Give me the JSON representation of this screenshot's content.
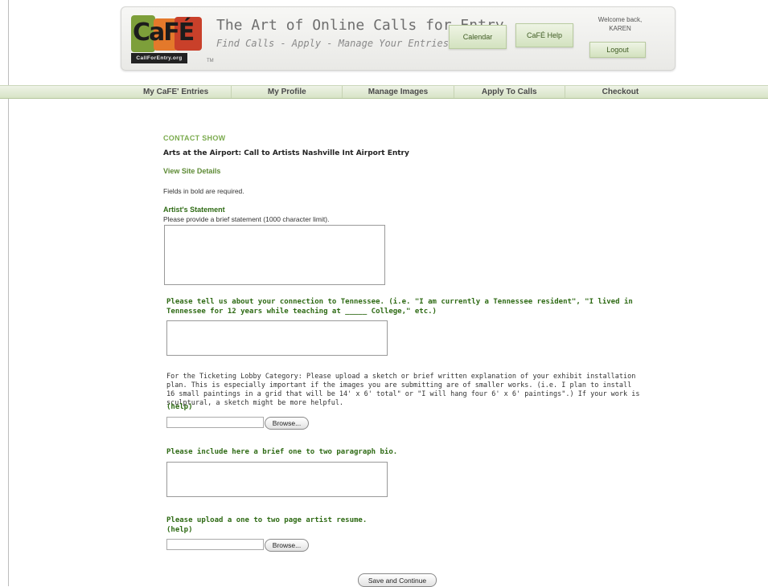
{
  "header": {
    "logo_text": "CaFÉ",
    "logo_sub": "CallForEntry.org",
    "trademark": "TM",
    "tagline_main": "The Art of Online Calls for Entry",
    "tagline_sub": "Find Calls - Apply - Manage Your Entries",
    "calendar_label": "Calendar",
    "help_label": "CaFÉ Help",
    "welcome_line1": "Welcome back,",
    "welcome_name": "KAREN",
    "logout_label": "Logout"
  },
  "nav": {
    "items": [
      "My CaFE' Entries",
      "My Profile",
      "Manage Images",
      "Apply To Calls",
      "Checkout"
    ]
  },
  "main": {
    "section_title": "CONTACT SHOW",
    "show_title": "Arts at the Airport: Call to Artists Nashville Int Airport Entry",
    "view_details": "View Site Details",
    "required_note": "Fields in bold are required.",
    "statement_label": "Artist's Statement",
    "statement_hint": "Please provide a brief statement (1000 character limit).",
    "tennessee_label": "Please tell us about your connection to Tennessee. (i.e. \"I am currently a Tennessee resident\", \"I lived in Tennessee for 12 years while teaching at _____ College,\" etc.)",
    "ticketing_text": "For the Ticketing Lobby Category: Please upload a sketch or brief written explanation of your exhibit installation plan. This is especially important if the images you are submitting are of smaller works. (i.e. I plan to install 16 small paintings in a grid that will be 14' x 6' total\" or \"I will hang four 6' x 6' paintings\".) If your work is sculptural, a sketch might be more helpful.",
    "help_link": "(help)",
    "browse_label": "Browse...",
    "bio_label": "Please include here a brief one to two paragraph bio.",
    "resume_label": "Please upload a one to two page artist resume.",
    "save_label": "Save and Continue"
  },
  "colors": {
    "accent_green": "#5d8a34",
    "label_green": "#2e6a14",
    "nav_bg": "#dfe9d1"
  }
}
